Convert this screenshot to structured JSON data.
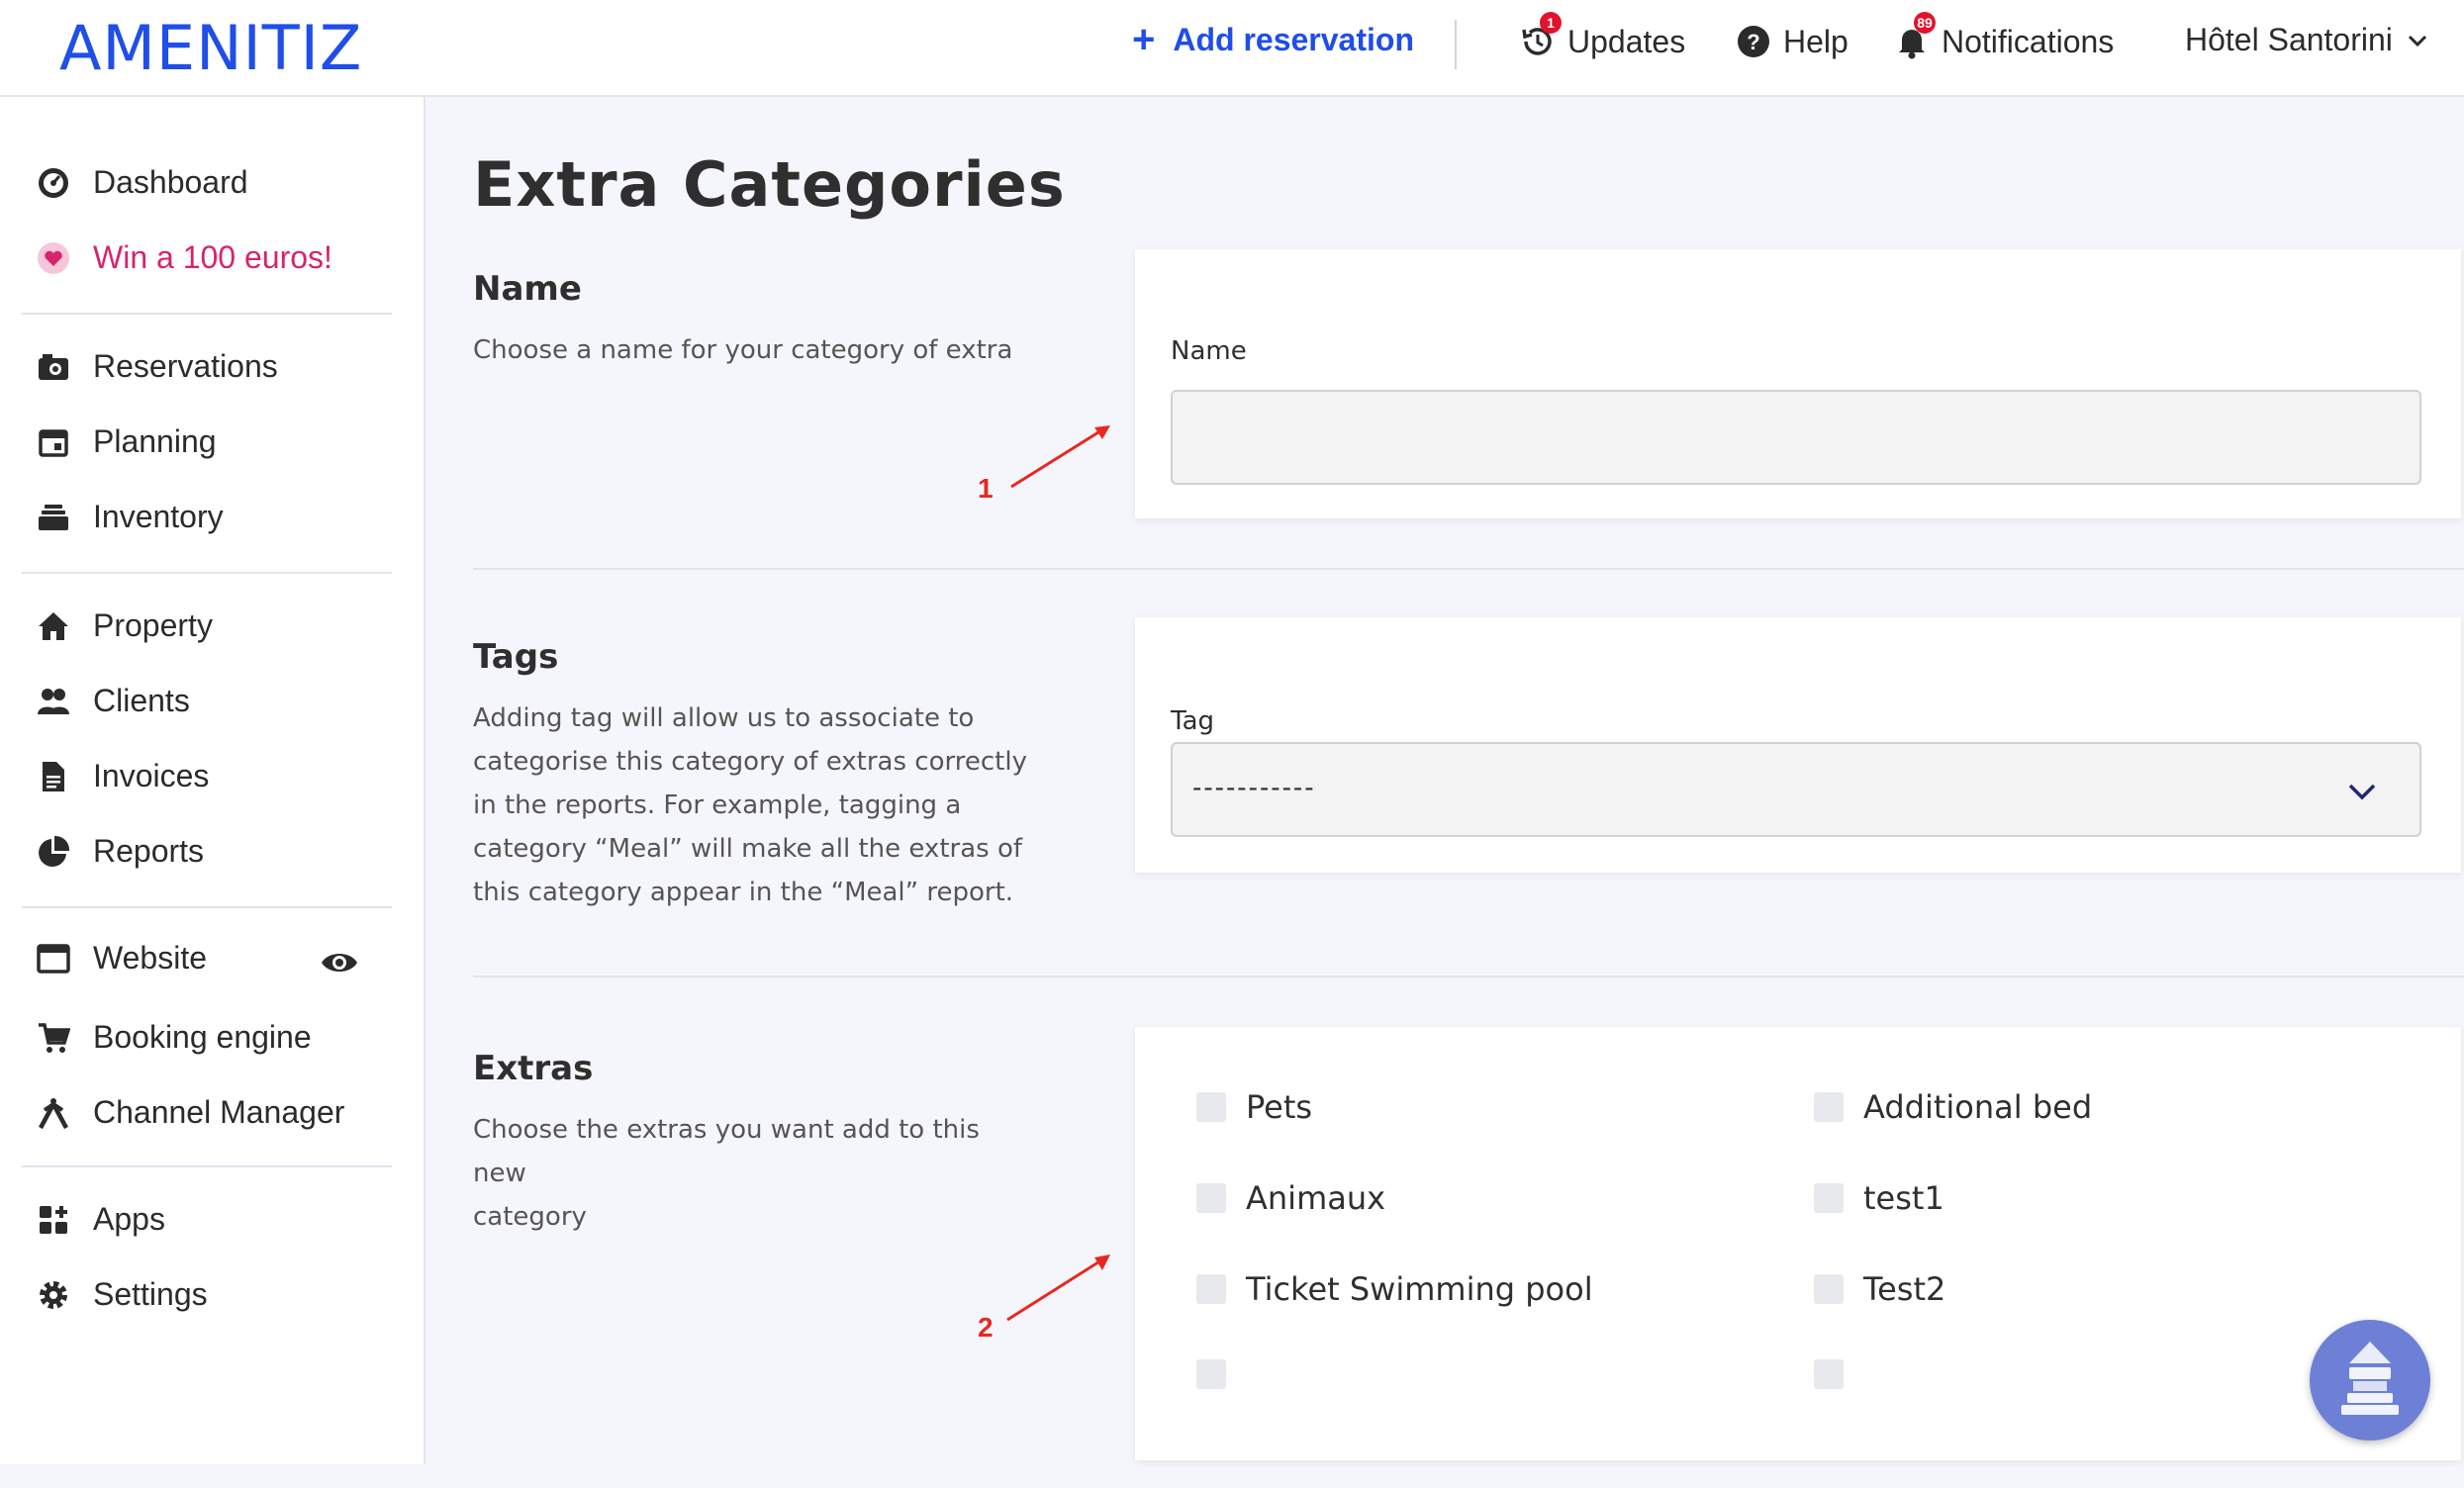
{
  "brand": {
    "logo_text": "AMENITIZ",
    "accent": "#1f4ee8",
    "promo_color": "#d6246e",
    "badge_color": "#e2132a"
  },
  "topbar": {
    "add_reservation": "Add reservation",
    "updates": {
      "label": "Updates",
      "icon": "history-icon",
      "badge": "1"
    },
    "help": {
      "label": "Help",
      "icon": "question-circle-icon"
    },
    "notifications": {
      "label": "Notifications",
      "icon": "bell-icon",
      "badge": "89"
    },
    "hotel": "Hôtel Santorini"
  },
  "sidebar": {
    "items": [
      {
        "label": "Dashboard",
        "icon": "gauge-icon"
      },
      {
        "label": "Win a 100 euros!",
        "icon": "heart-icon"
      },
      {
        "label": "Reservations",
        "icon": "camera-icon"
      },
      {
        "label": "Planning",
        "icon": "calendar-icon"
      },
      {
        "label": "Inventory",
        "icon": "layers-icon"
      },
      {
        "label": "Property",
        "icon": "home-icon"
      },
      {
        "label": "Clients",
        "icon": "users-icon"
      },
      {
        "label": "Invoices",
        "icon": "document-icon"
      },
      {
        "label": "Reports",
        "icon": "pie-chart-icon"
      },
      {
        "label": "Website",
        "icon": "browser-icon"
      },
      {
        "label": "Booking engine",
        "icon": "cart-icon"
      },
      {
        "label": "Channel Manager",
        "icon": "channel-icon"
      },
      {
        "label": "Apps",
        "icon": "apps-icon"
      },
      {
        "label": "Settings",
        "icon": "gear-icon"
      }
    ]
  },
  "main": {
    "title": "Extra Categories",
    "name_section": {
      "title": "Name",
      "description": "Choose a name for your category of extra",
      "field_label": "Name",
      "value": ""
    },
    "tags_section": {
      "title": "Tags",
      "description_lines": [
        "Adding tag will allow us to associate to",
        "categorise this category of extras correctly",
        "in the reports. For example, tagging a",
        "category “Meal” will make all the extras of",
        "this category appear in the “Meal” report."
      ],
      "field_label": "Tag",
      "selected": "-----------"
    },
    "extras_section": {
      "title": "Extras",
      "description_lines": [
        "Choose the extras you want add to this new",
        "category"
      ],
      "left": [
        "Pets",
        "Animaux",
        "Ticket Swimming pool",
        ""
      ],
      "right": [
        "Additional bed",
        "test1",
        "Test2",
        ""
      ]
    },
    "annotations": [
      "1",
      "2"
    ]
  }
}
